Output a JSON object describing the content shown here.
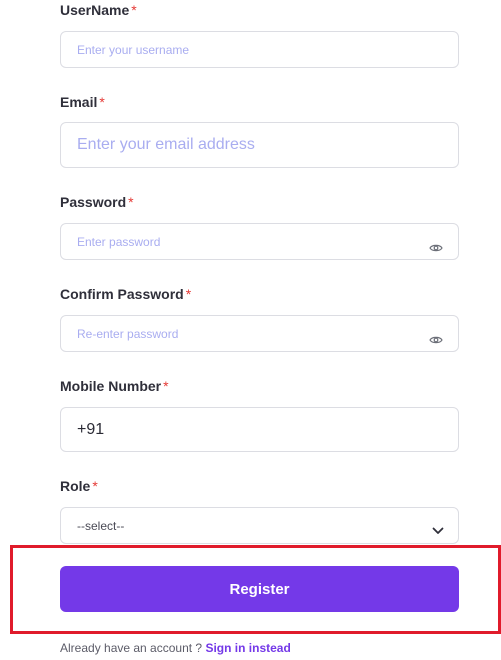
{
  "form": {
    "username": {
      "label": "UserName",
      "required_mark": "*",
      "placeholder": "Enter your username",
      "value": ""
    },
    "email": {
      "label": "Email",
      "required_mark": "*",
      "placeholder": "Enter your email address",
      "value": ""
    },
    "password": {
      "label": "Password",
      "required_mark": "*",
      "placeholder": "Enter password",
      "value": "",
      "toggle_icon": "eye-icon"
    },
    "confirm_password": {
      "label": "Confirm Password",
      "required_mark": "*",
      "placeholder": "Re-enter password",
      "value": "",
      "toggle_icon": "eye-icon"
    },
    "mobile": {
      "label": "Mobile Number",
      "required_mark": "*",
      "value": "+91"
    },
    "role": {
      "label": "Role",
      "required_mark": "*",
      "selected": "--select--",
      "icon": "chevron-down-icon"
    },
    "register_label": "Register",
    "footer_text": "Already have an account ?",
    "footer_link": "Sign in instead"
  },
  "colors": {
    "accent": "#7439e8",
    "required": "#e53935",
    "highlight": "#e01b2b",
    "placeholder": "#a9adf0"
  }
}
